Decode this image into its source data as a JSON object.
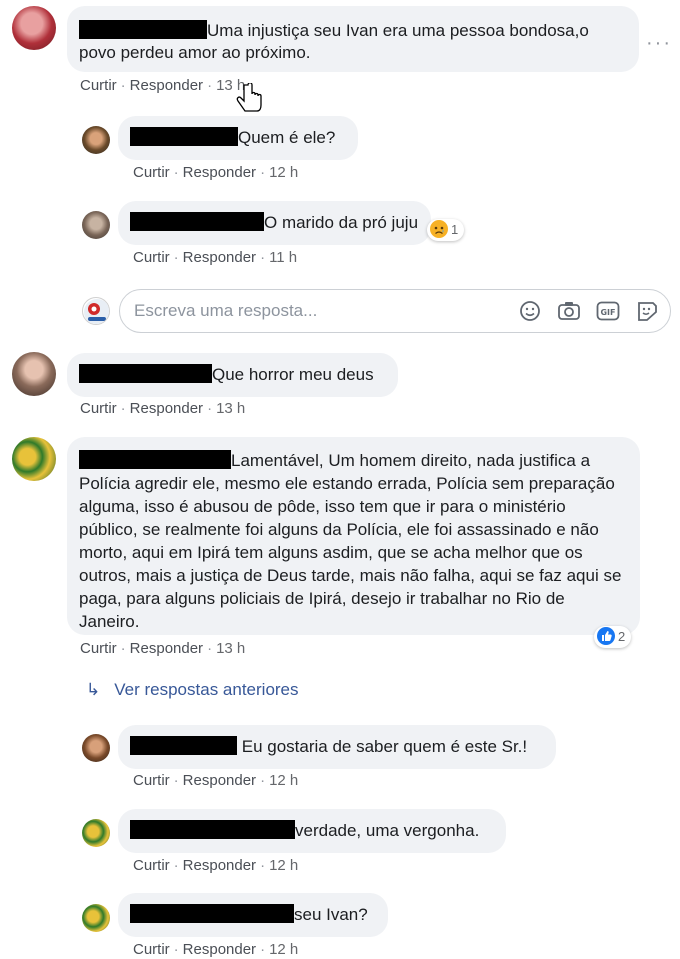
{
  "comments": [
    {
      "text": "Uma injustiça seu Ivan era uma pessoa bondosa,o povo perdeu amor ao próximo.",
      "like": "Curtir",
      "reply": "Responder",
      "time": "13 h"
    },
    {
      "text": "Quem é ele?",
      "like": "Curtir",
      "reply": "Responder",
      "time": "12 h"
    },
    {
      "text": "O marido da pró juju",
      "like": "Curtir",
      "reply": "Responder",
      "time": "11 h",
      "reaction_count": "1",
      "reaction_icon": "sad-emoji-icon"
    },
    {
      "text": "Que horror meu deus",
      "like": "Curtir",
      "reply": "Responder",
      "time": "13 h"
    },
    {
      "text": "Lamentável, Um homem direito, nada justifica a Polícia agredir ele, mesmo ele estando errada, Polícia sem preparação alguma, isso é abusou de pôde, isso tem que ir para o ministério público, se realmente foi alguns da Polícia, ele foi assassinado e não morto, aqui em Ipirá tem alguns asdim, que se acha melhor que os outros, mais a justiça de Deus tarde, mais não falha, aqui se faz aqui se paga, para alguns policiais de Ipirá, desejo ir trabalhar no Rio de Janeiro.",
      "like": "Curtir",
      "reply": "Responder",
      "time": "13 h",
      "reaction_count": "2",
      "reaction_icon": "like-icon"
    },
    {
      "text": "Eu gostaria de saber quem é este Sr.!",
      "like": "Curtir",
      "reply": "Responder",
      "time": "12 h"
    },
    {
      "text": "verdade, uma vergonha.",
      "like": "Curtir",
      "reply": "Responder",
      "time": "12 h"
    },
    {
      "text": "seu Ivan?",
      "like": "Curtir",
      "reply": "Responder",
      "time": "12 h"
    }
  ],
  "reply_input": {
    "placeholder": "Escreva uma resposta..."
  },
  "view_previous": "Ver respostas anteriores",
  "icons": {
    "emoji": "emoji-icon",
    "camera": "camera-icon",
    "gif": "gif-icon",
    "sticker": "sticker-icon",
    "more": "more-options-icon"
  },
  "colors": {
    "bubble": "#f0f2f5",
    "link": "#385898",
    "like_blue": "#1877f2",
    "sad_yellow": "#f7b125"
  }
}
